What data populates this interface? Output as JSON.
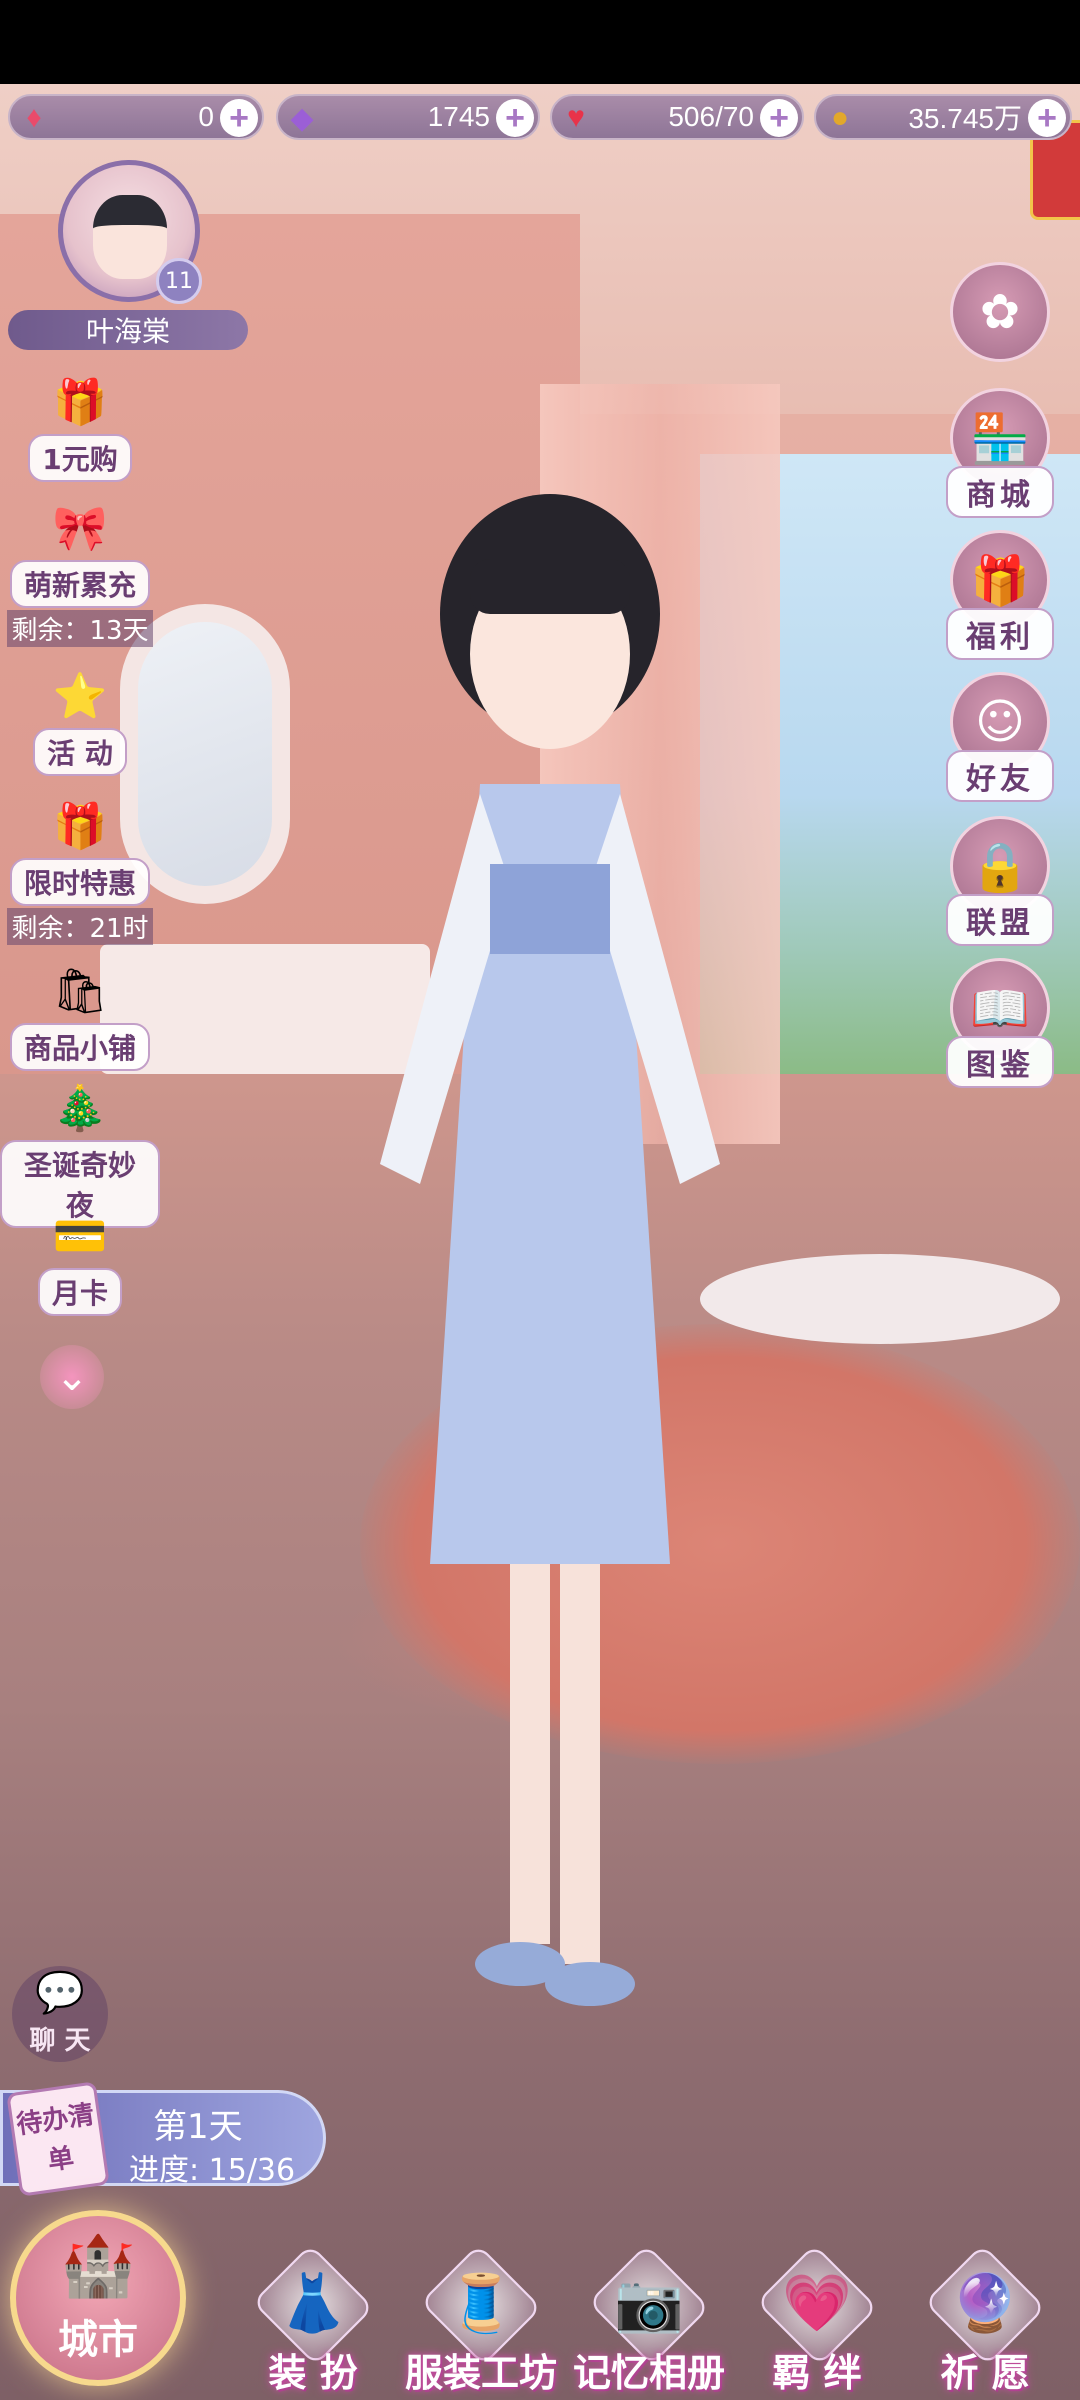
{
  "resources": [
    {
      "icon": "red-gem-icon",
      "glyph": "♦",
      "color": "#e94b6b",
      "value": "0"
    },
    {
      "icon": "purple-diamond-icon",
      "glyph": "◆",
      "color": "#9b5fd6",
      "value": "1745"
    },
    {
      "icon": "heart-icon",
      "glyph": "♥",
      "color": "#e8334a",
      "value": "506/70"
    },
    {
      "icon": "gold-coin-icon",
      "glyph": "●",
      "color": "#e2a82b",
      "value": "35.745万"
    }
  ],
  "player": {
    "name": "叶海棠",
    "level": "11"
  },
  "left_menu": [
    {
      "label": "1元购",
      "glyph": "🎁",
      "sub": ""
    },
    {
      "label": "萌新累充",
      "glyph": "🎀",
      "sub": "剩余：13天"
    },
    {
      "label": "活 动",
      "glyph": "⭐",
      "sub": ""
    },
    {
      "label": "限时特惠",
      "glyph": "🎁",
      "sub": "剩余：21时"
    },
    {
      "label": "商品小铺",
      "glyph": "🛍",
      "sub": ""
    },
    {
      "label": "圣诞奇妙夜",
      "glyph": "🎄",
      "sub": ""
    },
    {
      "label": "月卡",
      "glyph": "💳",
      "sub": ""
    }
  ],
  "right_menu": [
    {
      "label": "",
      "glyph": "✿"
    },
    {
      "label": "商城",
      "glyph": "🏪"
    },
    {
      "label": "福利",
      "glyph": "🎁"
    },
    {
      "label": "好友",
      "glyph": "☺"
    },
    {
      "label": "联盟",
      "glyph": "🔒"
    },
    {
      "label": "图鉴",
      "glyph": "📖"
    }
  ],
  "chat": {
    "label": "聊 天",
    "glyph": "💬"
  },
  "todo": {
    "badge": "待办清单",
    "day": "第1天",
    "progress": "进度: 15/36"
  },
  "bottom_nav": {
    "city": "城市",
    "items": [
      {
        "label": "装 扮",
        "glyph": "👗"
      },
      {
        "label": "服装工坊",
        "glyph": "🧵"
      },
      {
        "label": "记忆相册",
        "glyph": "📷"
      },
      {
        "label": "羁 绊",
        "glyph": "💗"
      },
      {
        "label": "祈 愿",
        "glyph": "🔮"
      }
    ]
  }
}
